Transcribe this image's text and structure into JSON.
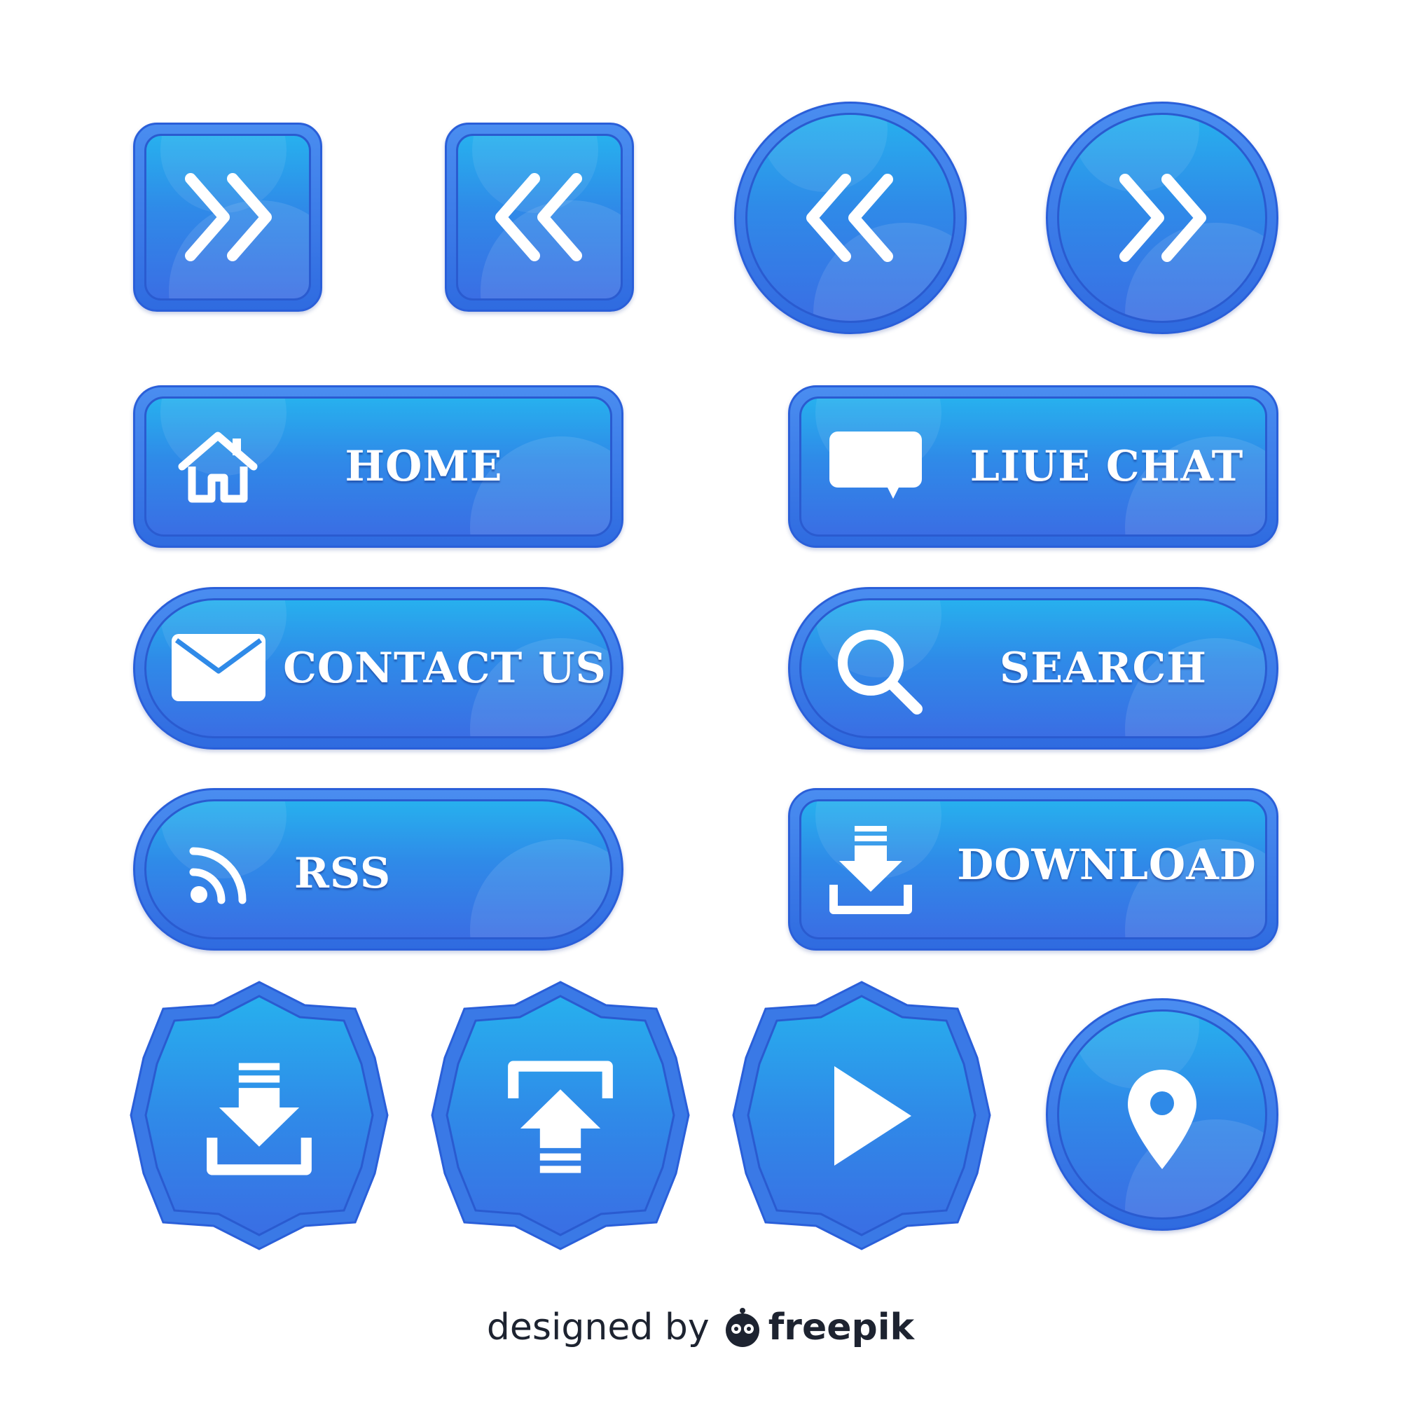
{
  "buttons": {
    "home": {
      "label": "HOME"
    },
    "live_chat": {
      "label": "LIUE CHAT"
    },
    "contact_us": {
      "label": "CONTACT US"
    },
    "search": {
      "label": "SEARCH"
    },
    "rss": {
      "label": "RSS"
    },
    "download": {
      "label": "DOWNLOAD"
    }
  },
  "icons": [
    "chevron-double-right-icon",
    "chevron-double-left-icon",
    "home-icon",
    "chat-bubble-icon",
    "envelope-icon",
    "magnifier-icon",
    "rss-icon",
    "download-icon",
    "upload-icon",
    "play-icon",
    "location-pin-icon"
  ],
  "colors": {
    "button_blue": "#2f8ae8",
    "border_blue": "#2a5fd9"
  },
  "footer": {
    "prefix": "designed by",
    "brand": "freepik"
  }
}
